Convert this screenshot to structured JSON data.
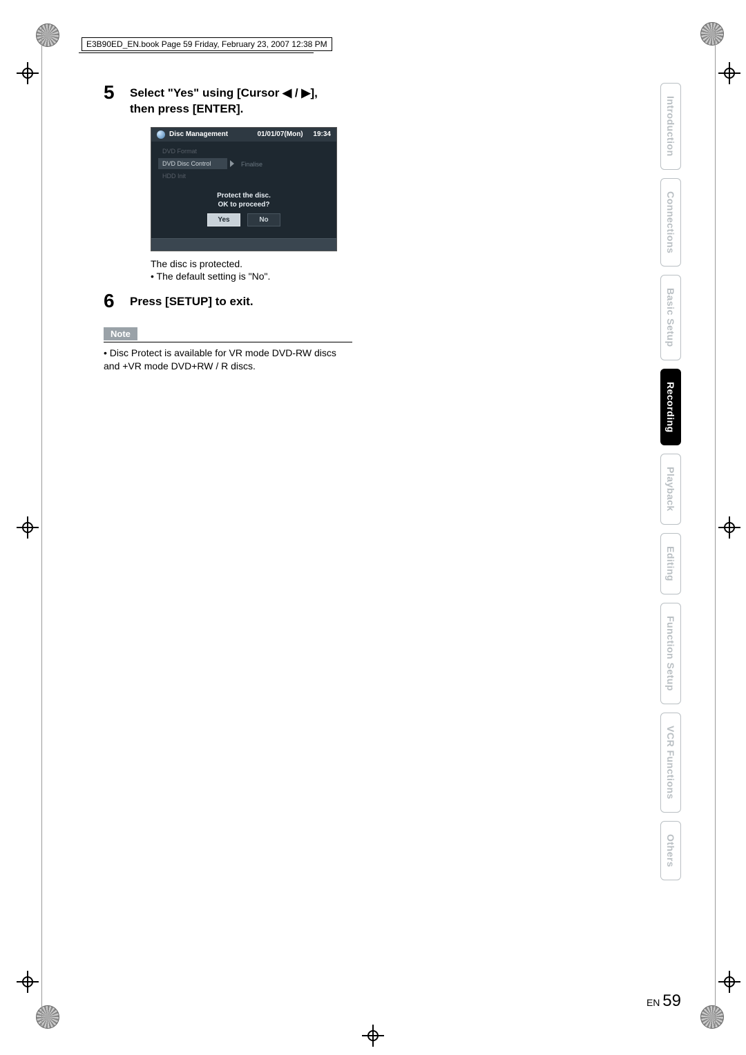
{
  "header": {
    "file_line": "E3B90ED_EN.book  Page 59  Friday, February 23, 2007  12:38 PM"
  },
  "steps": {
    "five": {
      "num": "5",
      "text_line1": "Select \"Yes\" using [Cursor ◀ / ▶],",
      "text_line2": "then press [ENTER]."
    },
    "six": {
      "num": "6",
      "text": "Press [SETUP] to exit."
    }
  },
  "screenshot": {
    "title": "Disc Management",
    "date": "01/01/07(Mon)",
    "time": "19:34",
    "menu": {
      "dvd_format": "DVD Format",
      "dvd_disc_control": "DVD Disc Control",
      "hdd_init": "HDD Init",
      "finalise": "Finalise"
    },
    "dialog": {
      "line1": "Protect the disc.",
      "line2": "OK to proceed?",
      "yes": "Yes",
      "no": "No"
    }
  },
  "caption": "The disc is protected.",
  "default_setting": "The default setting is \"No\".",
  "note": {
    "label": "Note",
    "text": "Disc Protect is available for VR mode DVD-RW discs and +VR mode DVD+RW / R discs."
  },
  "tabs": {
    "introduction": "Introduction",
    "connections": "Connections",
    "basic_setup": "Basic Setup",
    "recording": "Recording",
    "playback": "Playback",
    "editing": "Editing",
    "function_setup": "Function Setup",
    "vcr_functions": "VCR Functions",
    "others": "Others"
  },
  "page_num": {
    "prefix": "EN",
    "num": "59"
  }
}
